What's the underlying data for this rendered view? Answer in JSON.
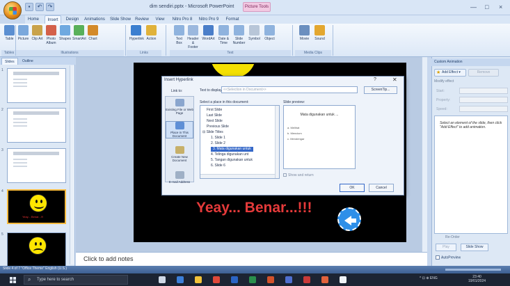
{
  "window": {
    "title": "dim sendiri.pptx - Microsoft PowerPoint",
    "context_tab": "Picture Tools",
    "controls": [
      "—",
      "□",
      "×"
    ]
  },
  "quick_access": [
    "save",
    "undo",
    "redo"
  ],
  "ribbon": {
    "tabs": [
      "Home",
      "Insert",
      "Design",
      "Animations",
      "Slide Show",
      "Review",
      "View",
      "Nitro Pro 8",
      "Nitro Pro 9",
      "Format"
    ],
    "active_tab": "Insert",
    "buttons": [
      {
        "label": "Table",
        "color": "#5b8fd1"
      },
      {
        "label": "Picture",
        "color": "#7aa8dc"
      },
      {
        "label": "Clip Art",
        "color": "#c9a34b"
      },
      {
        "label": "Photo Album",
        "color": "#d3604a"
      },
      {
        "label": "Shapes",
        "color": "#6fa9e0"
      },
      {
        "label": "SmartArt",
        "color": "#58b05a"
      },
      {
        "label": "Chart",
        "color": "#d38a2a"
      },
      {
        "label": "Hyperlink",
        "color": "#3b7fd0"
      },
      {
        "label": "Action",
        "color": "#e0b23a"
      },
      {
        "label": "Text Box",
        "color": "#8fb3de"
      },
      {
        "label": "Header & Footer",
        "color": "#9bb8de"
      },
      {
        "label": "WordArt",
        "color": "#4a7ec9"
      },
      {
        "label": "Date & Time",
        "color": "#8fb3de"
      },
      {
        "label": "Slide Number",
        "color": "#8fb3de"
      },
      {
        "label": "Symbol",
        "color": "#b8c6d8"
      },
      {
        "label": "Object",
        "color": "#8fb3de"
      },
      {
        "label": "Movie",
        "color": "#6b8fbf"
      },
      {
        "label": "Sound",
        "color": "#e3a72f"
      }
    ],
    "groups": [
      "Tables",
      "Illustrations",
      "Links",
      "Text",
      "Media Clips"
    ]
  },
  "slides_pane": {
    "tabs": [
      "Slides",
      "Outline"
    ],
    "slides": [
      {
        "num": "1",
        "type": "text"
      },
      {
        "num": "2",
        "type": "text"
      },
      {
        "num": "3",
        "type": "text"
      },
      {
        "num": "4",
        "type": "happy",
        "caption": "Yeay... Benar...!!!"
      },
      {
        "num": "5",
        "type": "sad"
      }
    ]
  },
  "slide": {
    "text": "Yeay... Benar...!!!"
  },
  "notes": {
    "placeholder": "Click to add notes"
  },
  "custom_animation": {
    "header": "Custom Animation",
    "add_effect": "Add Effect ▾",
    "remove": "Remove",
    "modify_label": "Modify effect",
    "fields": [
      "Start:",
      "Property:",
      "Speed:"
    ],
    "hint": "Select an element of the slide, then click \"Add Effect\" to add animation.",
    "reorder": "Re-Order",
    "play": "Play",
    "slide_show": "Slide Show",
    "autopreview": "AutoPreview"
  },
  "status": {
    "left": "Slide 4 of 7   \"Office Theme\"   English (U.S.)"
  },
  "taskbar": {
    "search_placeholder": "Type here to search",
    "tray": "^  ⊡  ⊕  ENG",
    "time": "23:40",
    "date": "19/01/2024",
    "icons": [
      {
        "name": "task-view-icon",
        "color": "#cfd8e6"
      },
      {
        "name": "store-icon",
        "color": "#3c7fd8"
      },
      {
        "name": "explorer-icon",
        "color": "#f2c23a"
      },
      {
        "name": "chrome-icon",
        "color": "#e0483a"
      },
      {
        "name": "word-icon",
        "color": "#2b64c4"
      },
      {
        "name": "excel-icon",
        "color": "#2a8f4c"
      },
      {
        "name": "powerpoint-icon",
        "color": "#d2522b"
      },
      {
        "name": "app-icon",
        "color": "#4f6fd0"
      },
      {
        "name": "app2-icon",
        "color": "#c93a3a"
      },
      {
        "name": "app3-icon",
        "color": "#e2623c"
      },
      {
        "name": "app4-icon",
        "color": "#f0f4f8"
      }
    ]
  },
  "dialog": {
    "title": "Insert Hyperlink",
    "help": "?",
    "close": "✕",
    "link_to_label": "Link to:",
    "link_to_items": [
      {
        "label": "Existing File or Web Page",
        "color": "#8aa6ce",
        "active": false
      },
      {
        "label": "Place in This Document",
        "color": "#5e8fd6",
        "active": true
      },
      {
        "label": "Create New Document",
        "color": "#c7b06a",
        "active": false
      },
      {
        "label": "E-mail Address",
        "color": "#9fb0c6",
        "active": false
      }
    ],
    "text_to_display_label": "Text to display:",
    "text_to_display_value": "<<Selection in Document>>",
    "screentip": "ScreenTip...",
    "select_place_label": "Select a place in this document:",
    "tree": [
      {
        "text": "First Slide",
        "indent": 1,
        "sel": false
      },
      {
        "text": "Last Slide",
        "indent": 1,
        "sel": false
      },
      {
        "text": "Next Slide",
        "indent": 1,
        "sel": false
      },
      {
        "text": "Previous Slide",
        "indent": 1,
        "sel": false
      },
      {
        "text": "⊟ Slide Titles",
        "indent": 0,
        "sel": false
      },
      {
        "text": "1. Slide 1",
        "indent": 2,
        "sel": false
      },
      {
        "text": "2. Slide 2",
        "indent": 2,
        "sel": false
      },
      {
        "text": "3. Mata digunakan untuk",
        "indent": 2,
        "sel": true
      },
      {
        "text": "4. Telinga digunakan unt",
        "indent": 2,
        "sel": false
      },
      {
        "text": "5. Tangan digunakan untuk",
        "indent": 2,
        "sel": false
      },
      {
        "text": "6. Slide 6",
        "indent": 2,
        "sel": false
      }
    ],
    "preview_label": "Slide preview:",
    "preview_title": "Mata digunakan untuk ...",
    "preview_lines": [
      "a. Melihat",
      "b. Mencium",
      "c. Mendengar"
    ],
    "show_return": "Show and return",
    "ok": "OK",
    "cancel": "Cancel"
  }
}
